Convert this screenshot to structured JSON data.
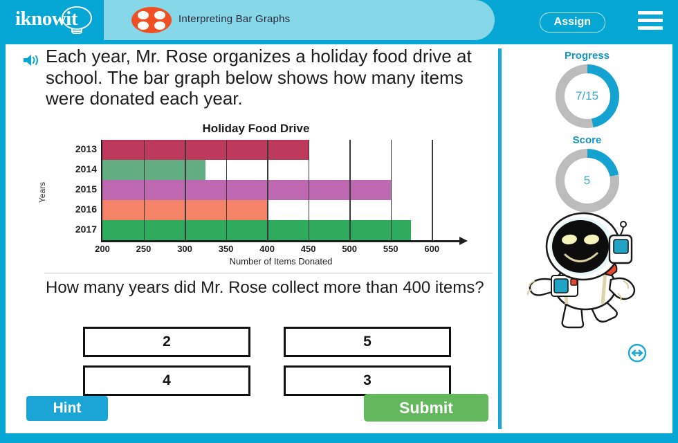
{
  "header": {
    "logo_text": "iknowit",
    "logo_icon": "lightbulb-icon",
    "tab_icon": "four-dots-icon",
    "tab_title": "Interpreting Bar Graphs",
    "assign_label": "Assign",
    "menu_icon": "hamburger-menu-icon",
    "brand_color": "#06a7d4",
    "tab_color": "#86d7e8",
    "tab_icon_color": "#f04e23"
  },
  "lesson": {
    "speaker_icon": "audio-speaker-icon",
    "prompt": "Each year, Mr. Rose organizes a holiday food drive at school. The bar graph below shows how many items were donated each year.",
    "question": "How many years did Mr. Rose collect more than 400 items?"
  },
  "answers": [
    {
      "label": "2"
    },
    {
      "label": "5"
    },
    {
      "label": "4"
    },
    {
      "label": "3"
    }
  ],
  "actions": {
    "hint_label": "Hint",
    "hint_color": "#1ba5d6",
    "submit_label": "Submit",
    "submit_color": "#63b85e"
  },
  "sidebar": {
    "progress": {
      "label": "Progress",
      "value_text": "7/15",
      "percent": 47,
      "fill_color": "#14a3d0",
      "track_color": "#bcbcbc"
    },
    "score": {
      "label": "Score",
      "value_text": "5",
      "percent": 22,
      "fill_color": "#14a3d0",
      "track_color": "#bcbcbc"
    },
    "mascot_icon": "astronaut-mascot",
    "resize_icon": "horizontal-resize-icon",
    "accent_color": "#19a8d8"
  },
  "chart_data": {
    "type": "bar",
    "orientation": "horizontal",
    "title": "Holiday Food Drive",
    "xlabel": "Number of Items Donated",
    "ylabel": "Years",
    "categories": [
      "2013",
      "2014",
      "2015",
      "2016",
      "2017"
    ],
    "values": [
      450,
      325,
      550,
      400,
      575
    ],
    "colors": [
      "#bd3a5c",
      "#63ad83",
      "#bd68b0",
      "#f58367",
      "#2fab5e"
    ],
    "xlim": [
      200,
      625
    ],
    "xticks": [
      200,
      250,
      300,
      350,
      400,
      450,
      500,
      550,
      600
    ],
    "grid": true,
    "legend": "none"
  }
}
